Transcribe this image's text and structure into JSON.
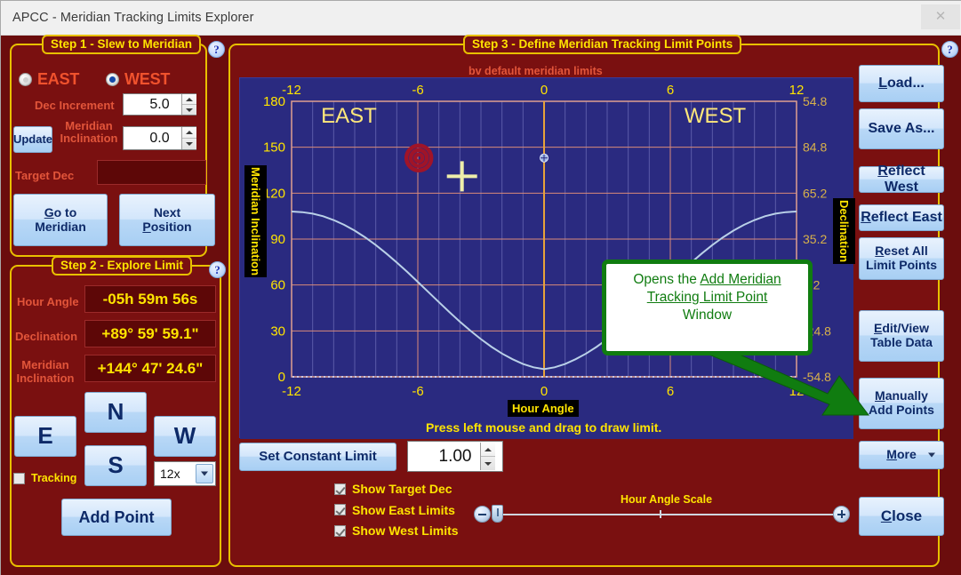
{
  "window": {
    "title": "APCC - Meridian Tracking Limits Explorer",
    "close_label": "✕"
  },
  "step1": {
    "caption": "Step 1 - Slew to Meridian",
    "help": "?",
    "radio_east": "EAST",
    "radio_west": "WEST",
    "selected_side": "WEST",
    "dec_increment_label": "Dec Increment",
    "dec_increment_value": "5.0",
    "update_label": "Update",
    "meridian_inclination_label_1": "Meridian",
    "meridian_inclination_label_2": "Inclination",
    "meridian_inclination_value": "0.0",
    "target_dec_label": "Target Dec",
    "target_dec_value": "",
    "goto_meridian_1": "Go to",
    "goto_meridian_2": "Meridian",
    "next_position_1": "Next",
    "next_position_2": "Position"
  },
  "step2": {
    "caption": "Step 2 - Explore Limit",
    "help": "?",
    "hour_angle_label": "Hour Angle",
    "hour_angle_value": "-05h 59m 56s",
    "declination_label": "Declination",
    "declination_value": "+89° 59' 59.1\"",
    "meridian_inclination_label_1": "Meridian",
    "meridian_inclination_label_2": "Inclination",
    "meridian_inclination_value": "+144° 47' 24.6\"",
    "north_label": "N",
    "south_label": "S",
    "east_label": "E",
    "west_label": "W",
    "rate_value": "12x",
    "tracking_label": "Tracking",
    "tracking_checked": false,
    "add_point_label": "Add Point"
  },
  "step3": {
    "caption": "Step 3 - Define Meridian Tracking Limit Points",
    "help": "?",
    "subtitle": "bv default meridian limits",
    "chart_hint": "Press left mouse and drag to draw limit.",
    "set_constant_limit_label": "Set Constant Limit",
    "constant_limit_value": "1.00",
    "checkboxes": [
      {
        "label": "Show Target Dec",
        "checked": true
      },
      {
        "label": "Show East Limits",
        "checked": true
      },
      {
        "label": "Show West Limits",
        "checked": true
      }
    ],
    "slider_label": "Hour Angle Scale"
  },
  "tooltip": {
    "line1_plain": "Opens the ",
    "line1_ul": "Add Meridian ",
    "line2_ul": "Tracking Limit Point ",
    "line3": "Window"
  },
  "sidebuttons": [
    {
      "name": "load",
      "line1": "Load...",
      "line2": "",
      "mnemonic": "L"
    },
    {
      "name": "save-as",
      "line1": "Save As...",
      "line2": "",
      "mnemonic": ""
    },
    {
      "name": "reflect-west",
      "line1": "Reflect West",
      "line2": "",
      "mnemonic": "R"
    },
    {
      "name": "reflect-east",
      "line1": "Reflect East",
      "line2": "",
      "mnemonic": "R"
    },
    {
      "name": "reset-all-limit-points",
      "line1": "Reset All",
      "line2": "Limit Points",
      "mnemonic": "R"
    },
    {
      "name": "edit-view-table-data",
      "line1": "Edit/View",
      "line2": "Table Data",
      "mnemonic": "E"
    },
    {
      "name": "manually-add-points",
      "line1": "Manually",
      "line2": "Add Points",
      "mnemonic": "M"
    }
  ],
  "more_button": {
    "label": "More",
    "mnemonic": "M"
  },
  "close_button": {
    "label": "Close",
    "mnemonic": "C"
  },
  "chart_data": {
    "type": "line",
    "title": "",
    "xlabel": "Hour Angle",
    "ylabel": "Meridian Inclination",
    "y2label": "Declination",
    "xlim": [
      -12,
      12
    ],
    "ylim": [
      0,
      180
    ],
    "xticks": [
      -12,
      -6,
      0,
      6,
      12
    ],
    "xticklabels": [
      "-12",
      "-6",
      "0",
      "6",
      "12"
    ],
    "yticks": [
      0,
      30,
      60,
      90,
      120,
      150,
      180
    ],
    "yticklabels": [
      "0",
      "30",
      "60",
      "90",
      "120",
      "150",
      "180"
    ],
    "y2ticklabels": [
      "54.8",
      "84.8",
      "65.2",
      "35.2",
      "5.2",
      "-24.8",
      "-54.8"
    ],
    "grid": true,
    "region_labels": [
      {
        "text": "EAST",
        "x": -10.6,
        "y": 166
      },
      {
        "text": "WEST",
        "x": 9.6,
        "y": 166
      }
    ],
    "series": [
      {
        "name": "default meridian limit",
        "color": "#b9d0e8",
        "x": [
          -12,
          -11.5,
          -11,
          -10.5,
          -10,
          -9.5,
          -9,
          -8.5,
          -8,
          -7.5,
          -7,
          -6.5,
          -6,
          -5.5,
          -5,
          -4.5,
          -4,
          -3.5,
          -3,
          -2.5,
          -2,
          -1.5,
          -1,
          -0.5,
          0,
          0.5,
          1,
          1.5,
          2,
          2.5,
          3,
          3.5,
          4,
          4.5,
          5,
          5.5,
          6,
          6.5,
          7,
          7.5,
          8,
          8.5,
          9,
          9.5,
          10,
          10.5,
          11,
          11.5,
          12
        ],
        "y": [
          108,
          107.6,
          106.6,
          104.9,
          102.4,
          99.3,
          95.5,
          91.1,
          86.1,
          80.6,
          74.7,
          68.5,
          62.0,
          55.4,
          48.8,
          42.3,
          36.0,
          30.1,
          24.6,
          19.6,
          15.2,
          11.5,
          8.4,
          6.2,
          5.0,
          6.2,
          8.4,
          11.5,
          15.2,
          19.6,
          24.6,
          30.1,
          36.0,
          42.3,
          48.8,
          55.4,
          62.0,
          68.5,
          74.7,
          80.6,
          86.1,
          91.1,
          95.5,
          99.3,
          102.4,
          104.9,
          106.6,
          107.6,
          108
        ]
      }
    ],
    "markers": [
      {
        "name": "target-dec-marker",
        "type": "bullseye",
        "x": -5.95,
        "y": 143,
        "color": "#a01428"
      },
      {
        "name": "mouse-crosshair",
        "type": "crosshair",
        "x": -3.9,
        "y": 131,
        "color": "#eeeeaa"
      },
      {
        "name": "meridian-point",
        "type": "dot",
        "x": 0.0,
        "y": 143,
        "color": "#9fb8e8"
      }
    ],
    "vlines": [
      {
        "name": "meridian-line",
        "x": 0,
        "color": "#e8a33a"
      }
    ],
    "baseline": {
      "name": "zero-limit-line",
      "y": 0,
      "color": "#c8c8e8",
      "style": "dotted"
    }
  }
}
